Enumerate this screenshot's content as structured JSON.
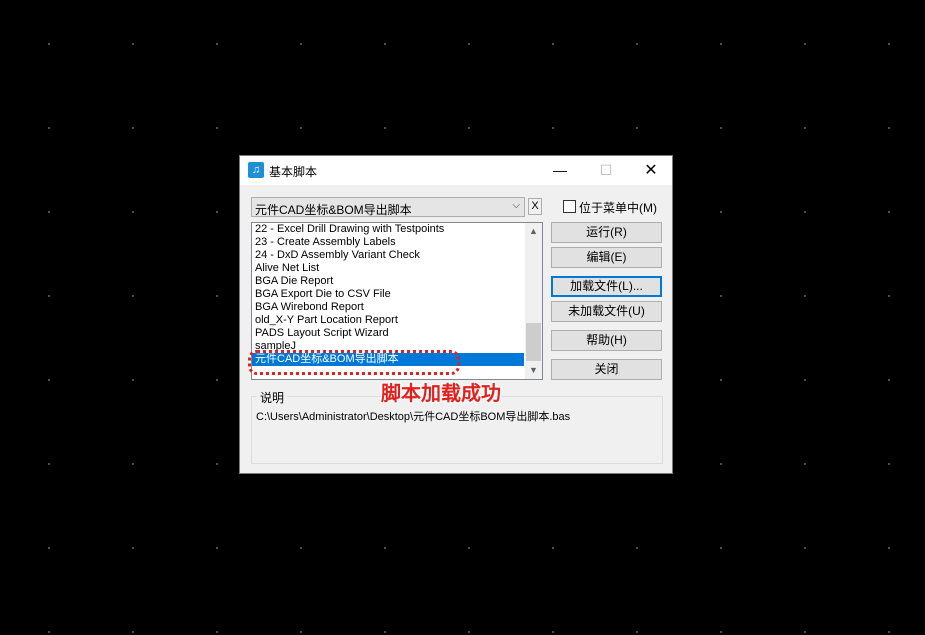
{
  "window": {
    "title": "基本脚本",
    "minimize": "—",
    "maximize": "☐",
    "close": "✕"
  },
  "combo": {
    "value": "元件CAD坐标&BOM导出脚本",
    "arrow": "⌵",
    "clear": "X"
  },
  "checkbox": {
    "label": "位于菜单中(M)",
    "checked": false
  },
  "list": {
    "items": [
      "22 - Excel Drill Drawing with Testpoints",
      "23 - Create Assembly Labels",
      "24 - DxD Assembly Variant Check",
      "Alive Net List",
      "BGA Die Report",
      "BGA Export Die to CSV File",
      "BGA Wirebond Report",
      "old_X-Y Part Location Report",
      "PADS Layout Script Wizard",
      "sampleJ",
      "元件CAD坐标&BOM导出脚本"
    ],
    "selected_index": 10
  },
  "buttons": {
    "run": "运行(R)",
    "edit": "编辑(E)",
    "load": "加载文件(L)...",
    "unload": "未加载文件(U)",
    "help": "帮助(H)",
    "close": "关闭"
  },
  "description": {
    "label": "说明",
    "text": "C:\\Users\\Administrator\\Desktop\\元件CAD坐标BOM导出脚本.bas"
  },
  "annotation": {
    "text": "脚本加载成功",
    "color": "#e0211d"
  },
  "colors": {
    "selection": "#0078d7",
    "accent": "#0078d7"
  }
}
